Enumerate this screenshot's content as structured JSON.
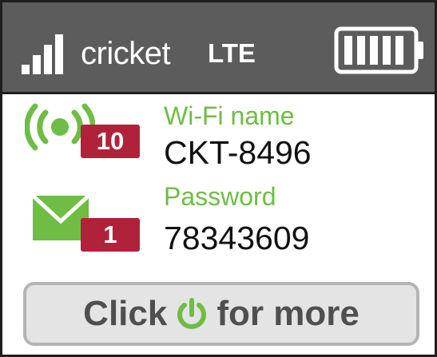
{
  "status_bar": {
    "carrier": "cricket",
    "network": "LTE",
    "signal_bars": 4,
    "battery_segments": 5,
    "battery_level": 1.0
  },
  "wifi": {
    "icon": "wifi-broadcast-icon",
    "connected_devices": "10",
    "label": "Wi-Fi name",
    "value": "CKT-8496"
  },
  "messages": {
    "icon": "envelope-icon",
    "unread_count": "1",
    "label": "Password",
    "value": "78343609"
  },
  "more_button": {
    "prefix": "Click",
    "icon": "power-icon",
    "suffix": "for more"
  },
  "colors": {
    "status_bar_bg": "#5c5c5c",
    "accent_green": "#6fbd44",
    "badge_red": "#b0223a",
    "button_bg": "#e4e4e4",
    "button_border": "#b4b4b4",
    "button_text": "#4f4f4f"
  }
}
